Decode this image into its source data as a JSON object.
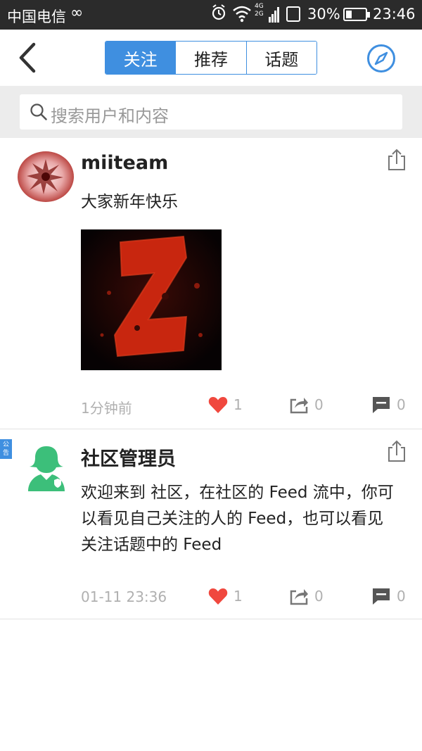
{
  "status_bar": {
    "carrier": "中国电信",
    "net_type_top": "4G",
    "net_type_bottom": "2G",
    "battery_percent": "30%",
    "battery_level": 0.3,
    "time": "23:46"
  },
  "navbar": {
    "tabs": [
      {
        "label": "关注",
        "active": true
      },
      {
        "label": "推荐",
        "active": false
      },
      {
        "label": "话题",
        "active": false
      }
    ],
    "accent_color": "#3f8fe0"
  },
  "search": {
    "placeholder": "搜索用户和内容"
  },
  "posts": [
    {
      "username": "miiteam",
      "text": "大家新年快乐",
      "time": "1分钟前",
      "likes": "1",
      "shares": "0",
      "comments": "0"
    },
    {
      "badge": "公告",
      "username": "社区管理员",
      "text": "欢迎来到 社区，在社区的 Feed 流中，你可以看见自己关注的人的 Feed，也可以看见关注话题中的 Feed",
      "time": "01-11 23:36",
      "likes": "1",
      "shares": "0",
      "comments": "0"
    }
  ],
  "colors": {
    "like": "#f0483e",
    "muted": "#b0b0b0",
    "admin_avatar": "#3cbf7a"
  },
  "icons": [
    "back-icon",
    "compass-icon",
    "search-icon",
    "share-icon",
    "heart-icon",
    "repost-icon",
    "comment-icon"
  ]
}
